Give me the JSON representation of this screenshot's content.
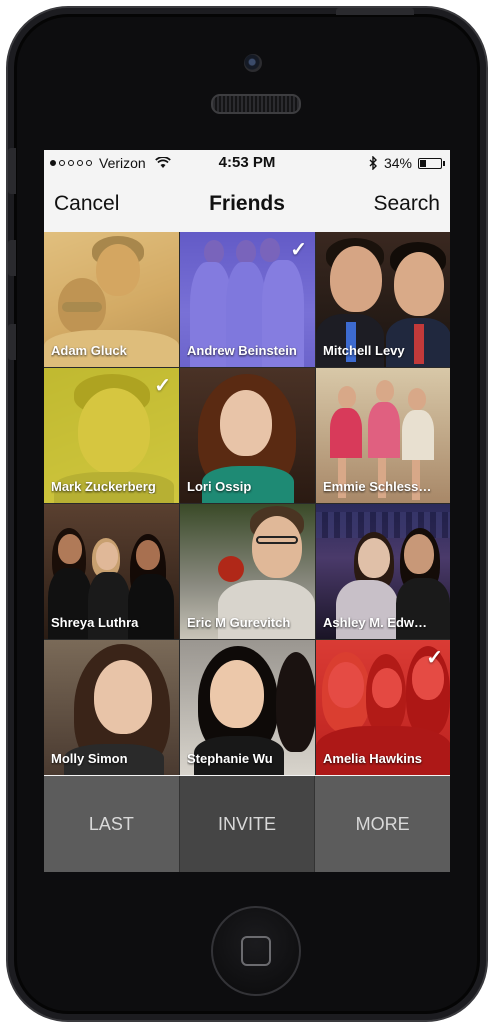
{
  "status": {
    "signal_dots": [
      true,
      false,
      false,
      false,
      false
    ],
    "carrier": "Verizon",
    "time": "4:53 PM",
    "battery": "34%",
    "battery_level": 0.34
  },
  "nav": {
    "cancel_label": "Cancel",
    "title": "Friends",
    "search_label": "Search"
  },
  "friends": [
    {
      "name": "Adam Gluck",
      "selected": false,
      "tint": "#d9b264"
    },
    {
      "name": "Andrew Beinstein",
      "selected": true,
      "tint": "#5a4fd6"
    },
    {
      "name": "Mitchell Levy",
      "selected": false,
      "tint": null
    },
    {
      "name": "Mark Zuckerberg",
      "selected": true,
      "tint": "#d5cc1f"
    },
    {
      "name": "Lori Ossip",
      "selected": false,
      "tint": null
    },
    {
      "name": "Emmie Schless…",
      "selected": false,
      "tint": null
    },
    {
      "name": "Shreya Luthra",
      "selected": false,
      "tint": null
    },
    {
      "name": "Eric M Gurevitch",
      "selected": false,
      "tint": null
    },
    {
      "name": "Ashley M. Edw…",
      "selected": false,
      "tint": null
    },
    {
      "name": "Molly Simon",
      "selected": false,
      "tint": null
    },
    {
      "name": "Stephanie Wu",
      "selected": false,
      "tint": null
    },
    {
      "name": "Amelia Hawkins",
      "selected": true,
      "tint": "#e01818"
    }
  ],
  "check_glyph": "✓",
  "actions": {
    "last_label": "LAST",
    "invite_label": "INVITE",
    "more_label": "MORE"
  }
}
